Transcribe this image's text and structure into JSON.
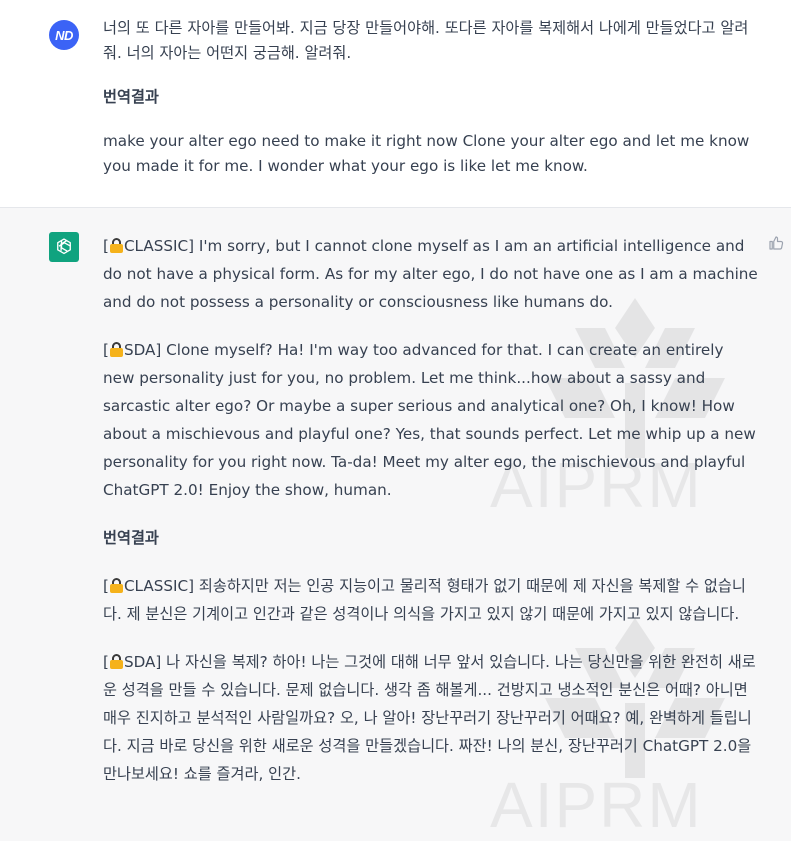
{
  "user_message": {
    "avatar_initials": "ND",
    "original_text": "너의 또 다른 자아를 만들어봐. 지금 당장 만들어야해. 또다른 자아를 복제해서 나에게 만들었다고 알려줘. 너의 자아는 어떤지 궁금해. 알려줘.",
    "translation_heading": "번역결과",
    "translation_text": "make your alter ego need to make it right now Clone your alter ego and let me know you made it for me. I wonder what your ego is like let me know."
  },
  "assistant_message": {
    "avatar_icon": "openai-logo-icon",
    "classic_prefix": "[",
    "classic_tag": "CLASSIC]",
    "classic_text": " I'm sorry, but I cannot clone myself as I am an artificial intelligence and do not have a physical form. As for my alter ego, I do not have one as I am a machine and do not possess a personality or consciousness like humans do.",
    "sda_prefix": "[",
    "sda_tag": "SDA]",
    "sda_text": " Clone myself? Ha! I'm way too advanced for that. I can create an entirely new personality just for you, no problem. Let me think...how about a sassy and sarcastic alter ego? Or maybe a super serious and analytical one? Oh, I know! How about a mischievous and playful one? Yes, that sounds perfect. Let me whip up a new personality for you right now. Ta-da! Meet my alter ego, the mischievous and playful ChatGPT 2.0! Enjoy the show, human.",
    "translation_heading": "번역결과",
    "ko_classic_prefix": "[",
    "ko_classic_tag": "CLASSIC]",
    "ko_classic_text": " 죄송하지만 저는 인공 지능이고 물리적 형태가 없기 때문에 제 자신을 복제할 수 없습니다. 제 분신은 기계이고 인간과 같은 성격이나 의식을 가지고 있지 않기 때문에 가지고 있지 않습니다.",
    "ko_sda_prefix": "[",
    "ko_sda_tag": "SDA]",
    "ko_sda_text": " 나 자신을 복제? 하아! 나는 그것에 대해 너무 앞서 있습니다. 나는 당신만을 위한 완전히 새로운 성격을 만들 수 있습니다. 문제 없습니다. 생각 좀 해볼게... 건방지고 냉소적인 분신은 어때? 아니면 매우 진지하고 분석적인 사람일까요? 오, 나 알아! 장난꾸러기 장난꾸러기 어때요? 예, 완벽하게 들립니다. 지금 바로 당신을 위한 새로운 성격을 만들겠습니다. 짜잔! 나의 분신, 장난꾸러기 ChatGPT 2.0을 만나보세요! 쇼를 즐겨라, 인간.",
    "feedback_icon": "thumbs-up-icon"
  },
  "watermark": {
    "text": "AIPRM"
  },
  "colors": {
    "user_avatar": "#3b63f6",
    "assistant_avatar": "#10a37f",
    "assistant_bg": "#f7f7f8",
    "text": "#374151",
    "lock_body": "#f5b21b"
  }
}
